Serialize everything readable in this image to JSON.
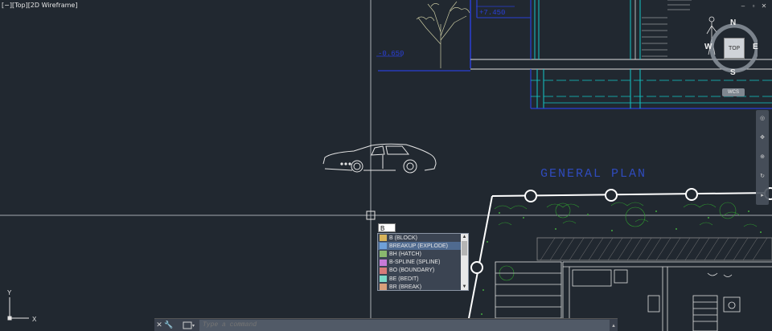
{
  "viewport": {
    "label": "[−][Top][2D Wireframe]",
    "window_controls": [
      "–",
      "▫",
      "✕"
    ]
  },
  "drawing": {
    "title": "GENERAL PLAN",
    "elevations": [
      "+7.450",
      "-0.650"
    ]
  },
  "command_input": {
    "value": "B"
  },
  "autocomplete": {
    "items": [
      {
        "label": "B (BLOCK)",
        "icon": "block-icon"
      },
      {
        "label": "BREAKUP (EXPLODE)",
        "icon": "explode-icon"
      },
      {
        "label": "BH (HATCH)",
        "icon": "hatch-icon"
      },
      {
        "label": "B-SPLINE (SPLINE)",
        "icon": "spline-icon"
      },
      {
        "label": "BO (BOUNDARY)",
        "icon": "boundary-icon"
      },
      {
        "label": "BE (BEDIT)",
        "icon": "bedit-icon"
      },
      {
        "label": "BR (BREAK)",
        "icon": "break-icon"
      }
    ],
    "selected_index": 1
  },
  "command_line": {
    "placeholder": "Type a command"
  },
  "viewcube": {
    "top_label": "TOP",
    "north": "N",
    "south": "S",
    "east": "E",
    "west": "W",
    "wcs_label": "WCS"
  },
  "ucs": {
    "x_label": "X",
    "y_label": "Y"
  },
  "colors": {
    "background": "#212830",
    "drawing_line": "#ffffff",
    "cyan_line": "#12c8c8",
    "blue_line": "#2a3fd6",
    "green_line": "#2f9e2f",
    "title_text": "#2f4bbd"
  }
}
